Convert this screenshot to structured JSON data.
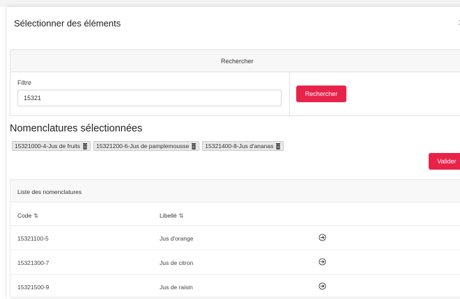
{
  "modal": {
    "title": "Sélectionner des éléments",
    "close": "x"
  },
  "search": {
    "header": "Rechercher",
    "filter_label": "Filtre",
    "filter_value": "15321",
    "button_label": "Rechercher"
  },
  "selected": {
    "title": "Nomenclatures sélectionnées",
    "chips": [
      "15321000-4-Jus de fruits",
      "15321200-6-Jus de pamplemousse",
      "15321400-8-Jus d'ananas"
    ],
    "validate_label": "Valider"
  },
  "list": {
    "title": "Liste des nomenclatures",
    "columns": {
      "code": "Code",
      "label": "Libellé",
      "sort_glyph": "⇅"
    },
    "rows": [
      {
        "code": "15321100-5",
        "label": "Jus d'orange"
      },
      {
        "code": "15321300-7",
        "label": "Jus de citron"
      },
      {
        "code": "15321500-9",
        "label": "Jus de raisin"
      }
    ]
  },
  "colors": {
    "accent": "#e8234a"
  }
}
